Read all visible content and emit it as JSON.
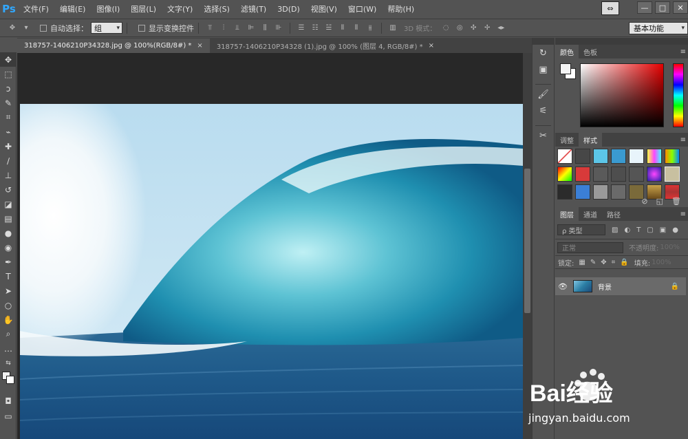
{
  "app": {
    "logo": "Ps"
  },
  "menu": [
    "文件(F)",
    "编辑(E)",
    "图像(I)",
    "图层(L)",
    "文字(Y)",
    "选择(S)",
    "滤镜(T)",
    "3D(D)",
    "视图(V)",
    "窗口(W)",
    "帮助(H)"
  ],
  "window_controls": {
    "arrange": "⇔",
    "minimize": "—",
    "restore": "□",
    "close": "✕"
  },
  "options": {
    "auto_select_label": "自动选择：",
    "auto_select_value": "组",
    "show_transform_label": "显示变换控件",
    "mode3d_label": "3D 模式：",
    "workspace": "基本功能"
  },
  "tabs": [
    {
      "title": "318757-1406210P34328.jpg @ 100%(RGB/8#) *",
      "close": "×"
    },
    {
      "title": "318757-1406210P34328 (1).jpg @ 100% (图层 4, RGB/8#) *",
      "close": "×"
    }
  ],
  "tools": [
    {
      "name": "move-tool-icon",
      "glyph": "✥"
    },
    {
      "name": "marquee-tool-icon",
      "glyph": "⬚"
    },
    {
      "name": "lasso-tool-icon",
      "glyph": "ↄ"
    },
    {
      "name": "quick-select-tool-icon",
      "glyph": "✎"
    },
    {
      "name": "crop-tool-icon",
      "glyph": "⌗"
    },
    {
      "name": "eyedropper-tool-icon",
      "glyph": "⌁"
    },
    {
      "name": "healing-tool-icon",
      "glyph": "✚"
    },
    {
      "name": "brush-tool-icon",
      "glyph": "∕"
    },
    {
      "name": "clone-stamp-tool-icon",
      "glyph": "⊥"
    },
    {
      "name": "history-brush-tool-icon",
      "glyph": "↺"
    },
    {
      "name": "eraser-tool-icon",
      "glyph": "◪"
    },
    {
      "name": "gradient-tool-icon",
      "glyph": "▤"
    },
    {
      "name": "blur-tool-icon",
      "glyph": "●"
    },
    {
      "name": "dodge-tool-icon",
      "glyph": "◉"
    },
    {
      "name": "pen-tool-icon",
      "glyph": "✒"
    },
    {
      "name": "type-tool-icon",
      "glyph": "T"
    },
    {
      "name": "path-select-tool-icon",
      "glyph": "➤"
    },
    {
      "name": "shape-tool-icon",
      "glyph": "○"
    },
    {
      "name": "hand-tool-icon",
      "glyph": "✋"
    },
    {
      "name": "zoom-tool-icon",
      "glyph": "⌕"
    },
    {
      "name": "more-tools-icon",
      "glyph": "…"
    }
  ],
  "panels": {
    "color_tabs": [
      "颜色",
      "色板"
    ],
    "styles_tabs": [
      "调整",
      "样式"
    ],
    "layers_tabs": [
      "图层",
      "通道",
      "路径"
    ],
    "panel_menu": "≡",
    "layer_filter": "ρ 类型",
    "blend_mode": "正常",
    "opacity_label": "不透明度:",
    "opacity_value": "100%",
    "lock_label": "锁定:",
    "fill_label": "填充:",
    "fill_value": "100%",
    "layer": {
      "name": "背景",
      "visible_icon": "👁",
      "lock_icon": "🔒"
    }
  },
  "watermark": {
    "brand": "Bai经验",
    "url": "jingyan.baidu.com"
  }
}
